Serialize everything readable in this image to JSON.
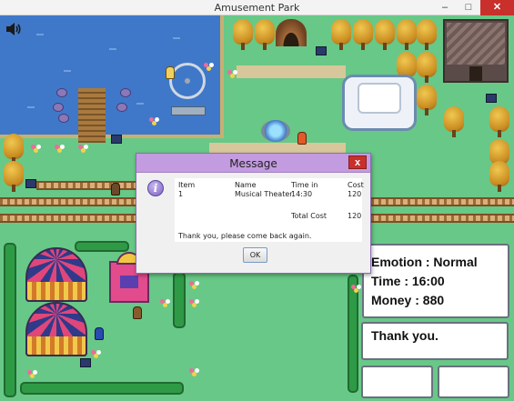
{
  "window": {
    "title": "Amusement Park",
    "minimize": "–",
    "maximize": "□",
    "close": "✕"
  },
  "map": {
    "sound_icon": "speaker-icon",
    "lake_color": "#3f78c8",
    "grass_color": "#68c887"
  },
  "status": {
    "emotion": "Emotion : Normal",
    "time": "Time : 16:00",
    "money": "Money : 880"
  },
  "message_panel": {
    "text": "Thank you."
  },
  "dialog": {
    "title": "Message",
    "close": "x",
    "icon": "info-icon",
    "icon_glyph": "i",
    "headers": {
      "item": "Item",
      "name": "Name",
      "time": "Time in",
      "cost": "Cost"
    },
    "row": {
      "item": "1",
      "name": "Musical Theater",
      "time": "14:30",
      "cost": "120"
    },
    "total_label": "Total Cost",
    "total_value": "120",
    "footer": "Thank you, please come back again.",
    "ok": "OK"
  }
}
